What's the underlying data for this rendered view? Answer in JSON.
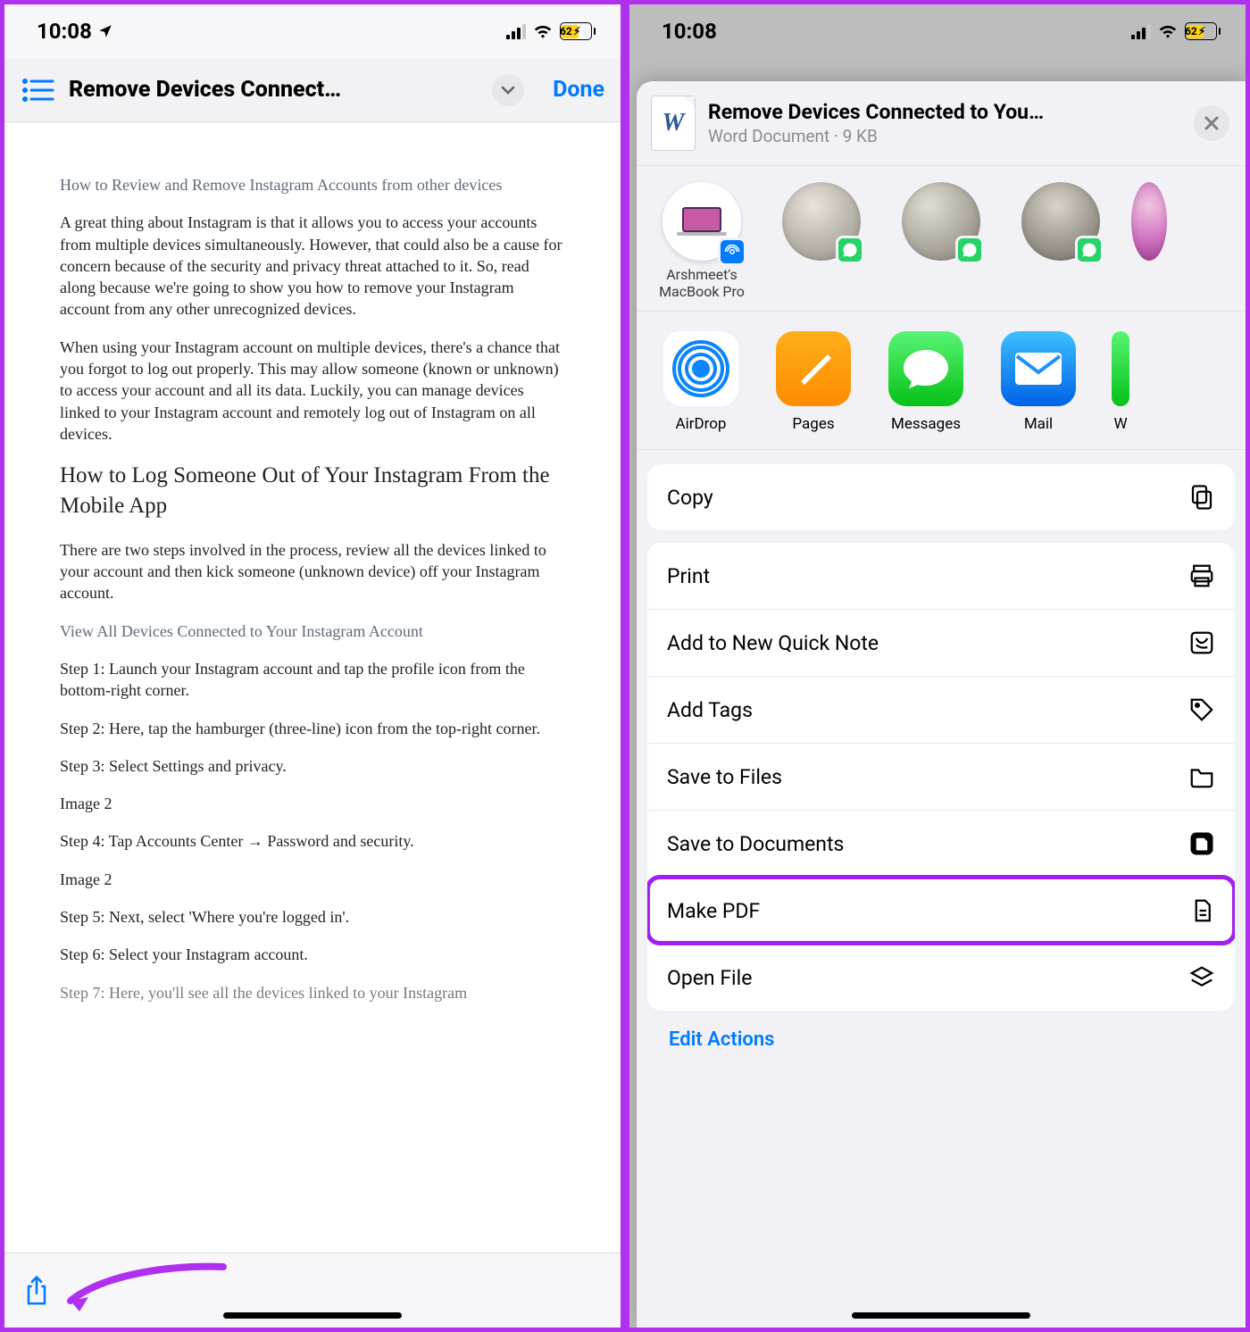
{
  "left": {
    "status": {
      "time": "10:08",
      "battery": "62"
    },
    "header": {
      "title": "Remove Devices Connect…",
      "done": "Done"
    },
    "doc": {
      "title_small": "How to Review and Remove Instagram Accounts from other devices",
      "p1": "A great thing about Instagram is that it allows you to access your accounts from multiple devices simultaneously. However, that could also be a cause for concern because of the security and privacy threat attached to it. So, read along because we're going to show you how to remove your Instagram account from any other unrecognized devices.",
      "p2": "When using your Instagram account on multiple devices, there's a chance that you forgot to log out properly. This may allow someone (known or unknown) to access your account and all its data. Luckily, you can manage devices linked to your Instagram account and remotely log out of Instagram on all devices.",
      "h2": "How to Log Someone Out of Your Instagram From the Mobile App",
      "p3": "There are two steps involved in the process, review all the devices linked to your account and then kick someone (unknown device) off your Instagram account.",
      "sub": "View All Devices Connected to Your Instagram Account",
      "s1": "Step 1: Launch your Instagram account and tap the profile icon from the bottom-right corner.",
      "s2": "Step 2: Here, tap the hamburger (three-line) icon from the top-right corner.",
      "s3": "Step 3: Select Settings and privacy.",
      "i1": "Image 2",
      "s4": "Step 4: Tap Accounts Center → Password and security.",
      "i2": "Image 2",
      "s5": "Step 5: Next, select 'Where you're logged in'.",
      "s6": "Step 6: Select your Instagram account.",
      "s7": "Step 7: Here, you'll see all the devices linked to your Instagram"
    }
  },
  "right": {
    "status": {
      "time": "10:08",
      "battery": "62"
    },
    "sheet": {
      "title": "Remove Devices Connected to You…",
      "subtitle": "Word Document · 9 KB",
      "thumb_letter": "W"
    },
    "targets": [
      {
        "label": "Arshmeet's MacBook Pro",
        "kind": "airdrop"
      },
      {
        "label": "",
        "kind": "whatsapp"
      },
      {
        "label": "",
        "kind": "whatsapp"
      },
      {
        "label": "",
        "kind": "whatsapp"
      }
    ],
    "apps": [
      {
        "label": "AirDrop",
        "kind": "airdrop"
      },
      {
        "label": "Pages",
        "kind": "pages"
      },
      {
        "label": "Messages",
        "kind": "messages"
      },
      {
        "label": "Mail",
        "kind": "mail"
      },
      {
        "label": "W",
        "kind": "cutoff"
      }
    ],
    "actions": {
      "copy": "Copy",
      "print": "Print",
      "quicknote": "Add to New Quick Note",
      "addtags": "Add Tags",
      "savefiles": "Save to Files",
      "savedocs": "Save to Documents",
      "makepdf": "Make PDF",
      "openfile": "Open File",
      "edit": "Edit Actions"
    }
  }
}
